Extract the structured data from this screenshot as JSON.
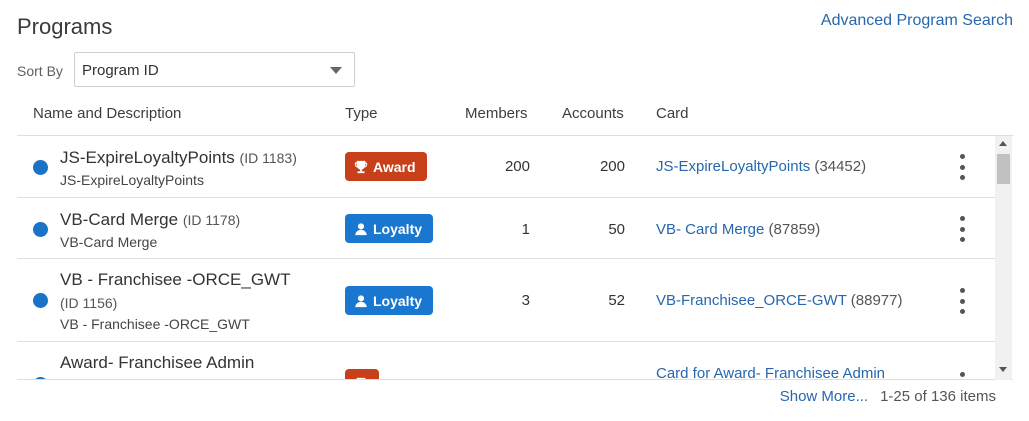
{
  "page": {
    "title": "Programs",
    "advanced_search": "Advanced Program Search",
    "sort_label": "Sort By",
    "sort_value": "Program ID"
  },
  "columns": {
    "name": "Name and Description",
    "type": "Type",
    "members": "Members",
    "accounts": "Accounts",
    "card": "Card"
  },
  "rows": [
    {
      "name": "JS-ExpireLoyaltyPoints",
      "id": "(ID 1183)",
      "desc": "JS-ExpireLoyaltyPoints",
      "type": "Award",
      "type_icon": "trophy-icon",
      "members": "200",
      "accounts": "200",
      "card": "JS-ExpireLoyaltyPoints",
      "card_id": "(34452)"
    },
    {
      "name": "VB-Card Merge",
      "id": "(ID 1178)",
      "desc": "VB-Card Merge",
      "type": "Loyalty",
      "type_icon": "person-icon",
      "members": "1",
      "accounts": "50",
      "card": "VB- Card Merge",
      "card_id": "(87859)"
    },
    {
      "name": "VB - Franchisee -ORCE_GWT",
      "id": "(ID 1156)",
      "desc": "VB - Franchisee -ORCE_GWT",
      "type": "Loyalty",
      "type_icon": "person-icon",
      "members": "3",
      "accounts": "52",
      "card": "VB-Franchisee_ORCE-GWT",
      "card_id": "(88977)"
    },
    {
      "name": "Award- Franchisee Admin",
      "card": "Card for Award- Franchisee Admin"
    }
  ],
  "footer": {
    "show_more": "Show More...",
    "count": "1-25 of 136 items"
  },
  "colors": {
    "link": "#2667ad",
    "award": "#c8401a",
    "loyalty": "#1a77cf",
    "status_dot": "#1b73c7"
  }
}
